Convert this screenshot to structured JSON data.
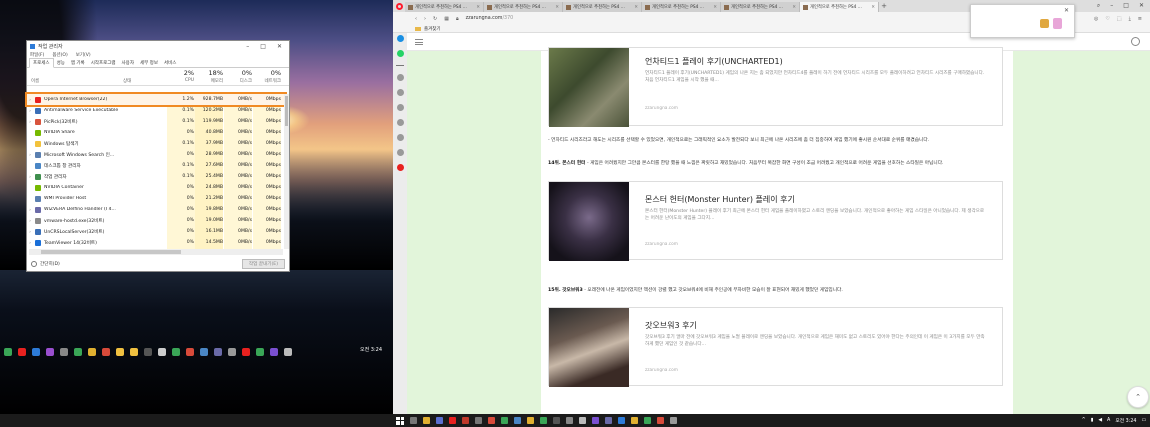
{
  "taskmgr": {
    "title": "작업 관리자",
    "menu": [
      "파일(F)",
      "옵션(O)",
      "보기(V)"
    ],
    "tabs": [
      "프로세스",
      "성능",
      "앱 기록",
      "시작프로그램",
      "사용자",
      "세부 정보",
      "서비스"
    ],
    "columns": {
      "name": "이름",
      "status": "상태",
      "cpu_pct": "2%",
      "cpu": "CPU",
      "mem_pct": "18%",
      "mem": "메모리",
      "disk_pct": "0%",
      "disk": "디스크",
      "net_pct": "0%",
      "net": "네트워크"
    },
    "rows": [
      {
        "name": "Opera Internet Browser(22)",
        "cpu": "1.2%",
        "mem": "928.7MB",
        "disk": "0MB/s",
        "net": "0Mbps",
        "selected": true,
        "color": "#e8211f",
        "expand": true
      },
      {
        "name": "Antimalware Service Executable",
        "cpu": "0.1%",
        "mem": "120.2MB",
        "disk": "0MB/s",
        "net": "0Mbps",
        "color": "#3a6fb7",
        "expand": true
      },
      {
        "name": "PicPick(32비트)",
        "cpu": "0.1%",
        "mem": "119.9MB",
        "disk": "0MB/s",
        "net": "0Mbps",
        "color": "#d8543e",
        "expand": true
      },
      {
        "name": "NVIDIA Share",
        "cpu": "0%",
        "mem": "40.8MB",
        "disk": "0MB/s",
        "net": "0Mbps",
        "color": "#76b900",
        "expand": false
      },
      {
        "name": "Windows 탐색기",
        "cpu": "0.1%",
        "mem": "37.9MB",
        "disk": "0MB/s",
        "net": "0Mbps",
        "color": "#f2c23c",
        "expand": false
      },
      {
        "name": "Microsoft Windows Search 인...",
        "cpu": "0%",
        "mem": "28.9MB",
        "disk": "0MB/s",
        "net": "0Mbps",
        "color": "#5a7fb0",
        "expand": true
      },
      {
        "name": "데스크톱 창 관리자",
        "cpu": "0.1%",
        "mem": "27.6MB",
        "disk": "0MB/s",
        "net": "0Mbps",
        "color": "#4a86c5",
        "expand": false
      },
      {
        "name": "작업 관리자",
        "cpu": "0.1%",
        "mem": "25.4MB",
        "disk": "0MB/s",
        "net": "0Mbps",
        "color": "#3f8f4e",
        "expand": true
      },
      {
        "name": "NVIDIA Container",
        "cpu": "0%",
        "mem": "24.8MB",
        "disk": "0MB/s",
        "net": "0Mbps",
        "color": "#76b900",
        "expand": false
      },
      {
        "name": "WMI Provider Host",
        "cpu": "0%",
        "mem": "21.2MB",
        "disk": "0MB/s",
        "net": "0Mbps",
        "color": "#5a7fb0",
        "expand": false
      },
      {
        "name": "WIZVERA Delfino Handler (I 4...",
        "cpu": "0%",
        "mem": "19.8MB",
        "disk": "0MB/s",
        "net": "0Mbps",
        "color": "#6a6aa8",
        "expand": true
      },
      {
        "name": "vmware-hostd.exe(32비트)",
        "cpu": "0%",
        "mem": "19.0MB",
        "disk": "0MB/s",
        "net": "0Mbps",
        "color": "#8a8a8a",
        "expand": true
      },
      {
        "name": "UnCRSLocalServer(32비트)",
        "cpu": "0%",
        "mem": "16.1MB",
        "disk": "0MB/s",
        "net": "0Mbps",
        "color": "#3a6fb7",
        "expand": true
      },
      {
        "name": "TeamViewer 14(32비트)",
        "cpu": "0%",
        "mem": "14.5MB",
        "disk": "0MB/s",
        "net": "0Mbps",
        "color": "#1a6fd8",
        "expand": true
      }
    ],
    "footer": {
      "simple": "간단히(D)",
      "end_task": "작업 끝내기(E)"
    }
  },
  "browser": {
    "tab_title": "개인적으로 추천하는 PS4 ...",
    "tab_count": 6,
    "url_host": "zzarungna.com",
    "url_path": "/370",
    "bookmark": "즐겨찾기",
    "accent": "#ff1b2d"
  },
  "page": {
    "card1": {
      "title": "언차티드1 플레이 후기(UNCHARTED1)",
      "desc": "언차티드1 플레이 후기(UNCHARTED1) 게임의 나온 지는 좀 되었지만 언차티드4를 플레이 하기 전에 언차티드 시리즈를 모두 플레이하려고 언차티드 시리즈를 구매하였습니다. 처음 언차티드1 게임을 시작 했을 때...",
      "source": "zzarungna.com"
    },
    "para1": "- 언차티드 시리즈라고 해도는 시리즈를 선택할 수 있었으면, 개인적으로는 그래픽적인 요소가 발전되다 보니 최근에 나온 시리즈에 좀 더 집중하여 게임 했기에 좋시원 순서대로 순위를 매겼습니다.",
    "para2_bold": "14위. 몬스터 헌터",
    "para2": " - 게임은 어려웠지만 그만큼 몬스터를 한탕 했을 때 느낌은 짜릿하고 재밌었습니다. 처음부터 복잡한 화면 구성이 조금 어려웠고 개인적으로 어려운 게임을 선호하는 스타일은 아닙니다.",
    "card2": {
      "title": "몬스터 헌터(Monster Hunter) 플레이 후기",
      "desc": "몬스터 헌터(Monster Hunter) 플레이 후기 최근에 몬스터 헌터 게임을 플레이하였고 스토리 엔딩을 보았습니다. 개인적으로 좋아하는 게임 스타일은 아니었습니다. 제 생각으로는 어려운 난이도의 게임을 그다지...",
      "source": "zzarungna.com"
    },
    "para3_bold": "15위. 갓오브워3",
    "para3": " - 오래전에 나온 게임이었지만 액션이 강렬 했고 갓오브워4에 비해 주인공에 무자비한 모습이 잘 표현되어 재밌게 했었던 게임입니다.",
    "card3": {
      "title": "갓오브워3 후기",
      "desc": "갓오브워3 후기 얼마 전에 갓오브워3 게임을 노멀 플레이로 엔딩을 보았습니다. 개인적으로 게임은 재미도 없고 스토리도 있어야 한다는 주의인데 이 게임은 이 3가지를 모두 만족하게 했던 게임인 것 같습니다...",
      "source": "zzarungna.com"
    }
  },
  "taskbar": {
    "time": "오전 3:24",
    "lang": "A"
  },
  "desktop": {
    "time": "오전 3:24"
  }
}
